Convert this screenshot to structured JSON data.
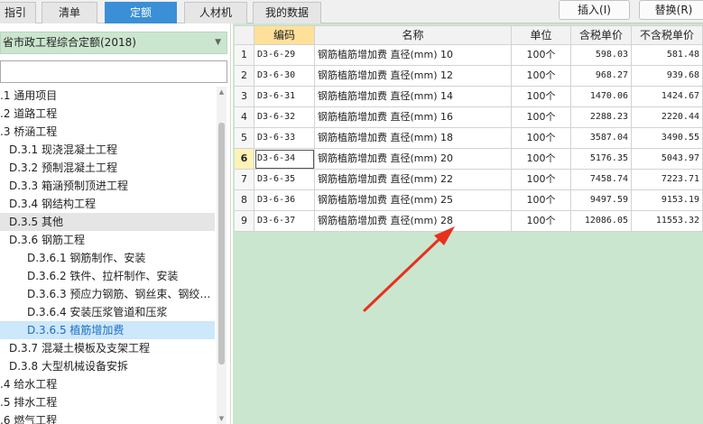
{
  "tabs": [
    {
      "label": "指引",
      "active": false
    },
    {
      "label": "清单",
      "active": false
    },
    {
      "label": "定额",
      "active": true
    },
    {
      "label": "人材机",
      "active": false
    },
    {
      "label": "我的数据",
      "active": false
    }
  ],
  "toolbar": {
    "insert_label": "插入(I)",
    "replace_label": "替换(R)"
  },
  "left": {
    "quota_library": "省市政工程综合定额(2018)",
    "search_value": "",
    "tree": [
      {
        "label": ".1 通用项目",
        "level": 0
      },
      {
        "label": ".2 道路工程",
        "level": 0
      },
      {
        "label": ".3 桥涵工程",
        "level": 0
      },
      {
        "label": "D.3.1 现浇混凝土工程",
        "level": 1
      },
      {
        "label": "D.3.2 预制混凝土工程",
        "level": 1
      },
      {
        "label": "D.3.3 箱涵预制顶进工程",
        "level": 1
      },
      {
        "label": "D.3.4 钢结构工程",
        "level": 1
      },
      {
        "label": "D.3.5 其他",
        "level": 1,
        "state": "gray"
      },
      {
        "label": "D.3.6 钢筋工程",
        "level": 1
      },
      {
        "label": "D.3.6.1 钢筋制作、安装",
        "level": 2
      },
      {
        "label": "D.3.6.2 铁件、拉杆制作、安装",
        "level": 2
      },
      {
        "label": "D.3.6.3 预应力钢筋、钢丝束、钢绞…",
        "level": 2
      },
      {
        "label": "D.3.6.4 安装压浆管道和压浆",
        "level": 2
      },
      {
        "label": "D.3.6.5 植筋增加费",
        "level": 2,
        "state": "blue"
      },
      {
        "label": "D.3.7 混凝土模板及支架工程",
        "level": 1
      },
      {
        "label": "D.3.8 大型机械设备安拆",
        "level": 1
      },
      {
        "label": ".4 给水工程",
        "level": 0
      },
      {
        "label": ".5 排水工程",
        "level": 0
      },
      {
        "label": ".6 燃气工程",
        "level": 0
      }
    ]
  },
  "table": {
    "headers": {
      "code": "编码",
      "name": "名称",
      "unit": "单位",
      "price_tax": "含税单价",
      "price_notax": "不含税单价"
    },
    "rows": [
      {
        "n": "1",
        "code": "D3-6-29",
        "name": "钢筋植筋增加费 直径(mm) 10",
        "unit": "100个",
        "price_tax": "598.03",
        "price_notax": "581.48"
      },
      {
        "n": "2",
        "code": "D3-6-30",
        "name": "钢筋植筋增加费 直径(mm) 12",
        "unit": "100个",
        "price_tax": "968.27",
        "price_notax": "939.68"
      },
      {
        "n": "3",
        "code": "D3-6-31",
        "name": "钢筋植筋增加费 直径(mm) 14",
        "unit": "100个",
        "price_tax": "1470.06",
        "price_notax": "1424.67"
      },
      {
        "n": "4",
        "code": "D3-6-32",
        "name": "钢筋植筋增加费 直径(mm) 16",
        "unit": "100个",
        "price_tax": "2288.23",
        "price_notax": "2220.44"
      },
      {
        "n": "5",
        "code": "D3-6-33",
        "name": "钢筋植筋增加费 直径(mm) 18",
        "unit": "100个",
        "price_tax": "3587.04",
        "price_notax": "3490.55"
      },
      {
        "n": "6",
        "code": "D3-6-34",
        "name": "钢筋植筋增加费 直径(mm) 20",
        "unit": "100个",
        "price_tax": "5176.35",
        "price_notax": "5043.97",
        "current": true
      },
      {
        "n": "7",
        "code": "D3-6-35",
        "name": "钢筋植筋增加费 直径(mm) 22",
        "unit": "100个",
        "price_tax": "7458.74",
        "price_notax": "7223.71"
      },
      {
        "n": "8",
        "code": "D3-6-36",
        "name": "钢筋植筋增加费 直径(mm) 25",
        "unit": "100个",
        "price_tax": "9497.59",
        "price_notax": "9153.19"
      },
      {
        "n": "9",
        "code": "D3-6-37",
        "name": "钢筋植筋增加费 直径(mm) 28",
        "unit": "100个",
        "price_tax": "12086.05",
        "price_notax": "11553.32"
      }
    ]
  },
  "colors": {
    "accent": "#3a8fd6",
    "grid_bg": "#cbe6cf",
    "arrow": "#e8301e",
    "tree_selected": "#cde7fb"
  }
}
